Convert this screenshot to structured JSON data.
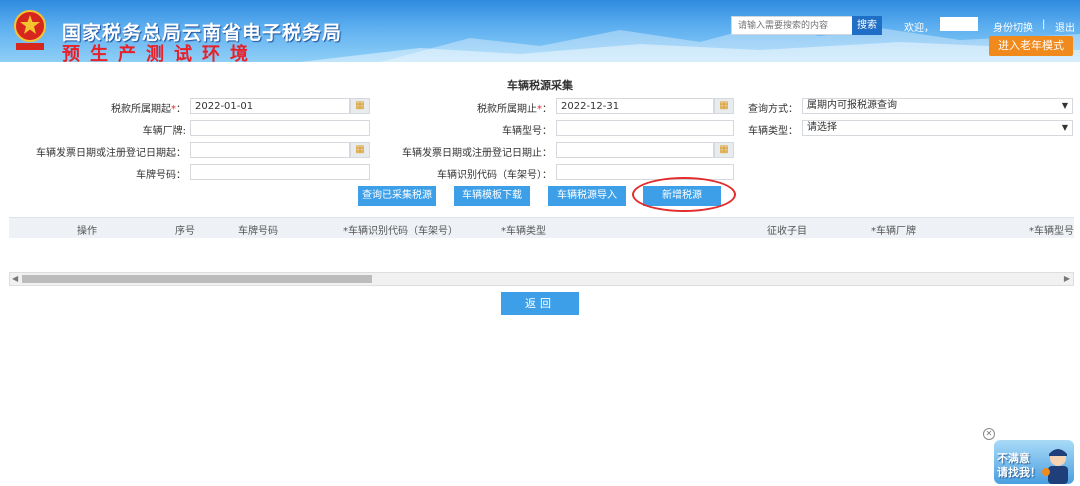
{
  "header": {
    "title": "国家税务总局云南省电子税务局",
    "env_label": "预生产测试环境",
    "emblem_text": "中国税务",
    "search_placeholder": "请输入需要搜索的内容",
    "search_button": "搜索",
    "welcome": "欢迎，",
    "identity_switch": "身份切换",
    "separator": "|",
    "logout": "退出",
    "elder_mode_button": "进入老年模式"
  },
  "page_title": "车辆税源采集",
  "form": {
    "period_start_label": "税款所属期起",
    "period_start_value": "2022-01-01",
    "period_end_label": "税款所属期止",
    "period_end_value": "2022-12-31",
    "query_mode_label": "查询方式：",
    "query_mode_value": "属期内可报税源查询",
    "brand_label": "车辆厂牌:",
    "brand_value": "",
    "model_label": "车辆型号：",
    "model_value": "",
    "vehicle_type_label": "车辆类型：",
    "vehicle_type_value": "请选择",
    "invoice_date_start_label": "车辆发票日期或注册登记日期起：",
    "invoice_date_start_value": "",
    "invoice_date_end_label": "车辆发票日期或注册登记日期止：",
    "invoice_date_end_value": "",
    "plate_label": "车牌号码：",
    "plate_value": "",
    "vin_label": "车辆识别代码（车架号）：",
    "vin_value": "",
    "colon_req": "：",
    "star": "*"
  },
  "actions": {
    "query_collected": "查询已采集税源",
    "template_download": "车辆模板下载",
    "import": "车辆税源导入",
    "add_new": "新增税源"
  },
  "table": {
    "columns": [
      "操作",
      "序号",
      "车牌号码",
      "*车辆识别代码（车架号）",
      "*车辆类型",
      "征收子目",
      "*车辆厂牌",
      "*车辆型号"
    ]
  },
  "back_button": "返回",
  "feedback_widget": {
    "text_line1": "不满意",
    "text_line2": "请找我！",
    "close": "✕"
  },
  "colors": {
    "header_blue": "#2f8be0",
    "button_blue": "#3d9fe8",
    "elder_orange": "#f18a1c",
    "env_red": "#e8202a",
    "highlight_red": "#e32b2b"
  }
}
